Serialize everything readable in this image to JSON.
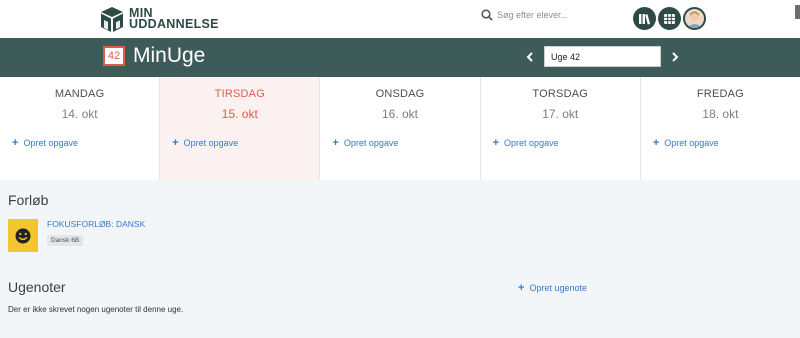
{
  "brand": {
    "line1": "MIN",
    "line2": "UDDANNELSE",
    "color": "#2e4a47"
  },
  "search": {
    "placeholder": "Søg efter elever...",
    "icon": "search-icon"
  },
  "header_icons": [
    "books-icon",
    "schedule-icon",
    "user-avatar"
  ],
  "page": {
    "badge": "42",
    "title": "MinUge",
    "accent": "#e35a4b",
    "header_bg": "#3d5c59"
  },
  "week_nav": {
    "current": "Uge 42",
    "prev_icon": "chevron-left-icon",
    "next_icon": "chevron-right-icon"
  },
  "days": [
    {
      "name": "MANDAG",
      "date": "14. okt",
      "add": "Opret opgave",
      "today": false
    },
    {
      "name": "TIRSDAG",
      "date": "15. okt",
      "add": "Opret opgave",
      "today": true
    },
    {
      "name": "ONSDAG",
      "date": "16. okt",
      "add": "Opret opgave",
      "today": false
    },
    {
      "name": "TORSDAG",
      "date": "17. okt",
      "add": "Opret opgave",
      "today": false
    },
    {
      "name": "FREDAG",
      "date": "18. okt",
      "add": "Opret opgave",
      "today": false
    }
  ],
  "courses_section": {
    "title": "Forløb",
    "items": [
      {
        "name": "FOKUSFORLØB: DANSK",
        "tag": "Dansk 6B",
        "icon": "smiley-icon"
      }
    ]
  },
  "notes_section": {
    "title": "Ugenoter",
    "add_label": "Opret ugenote",
    "empty_text": "Der er ikke skrevet nogen ugenoter til denne uge."
  }
}
